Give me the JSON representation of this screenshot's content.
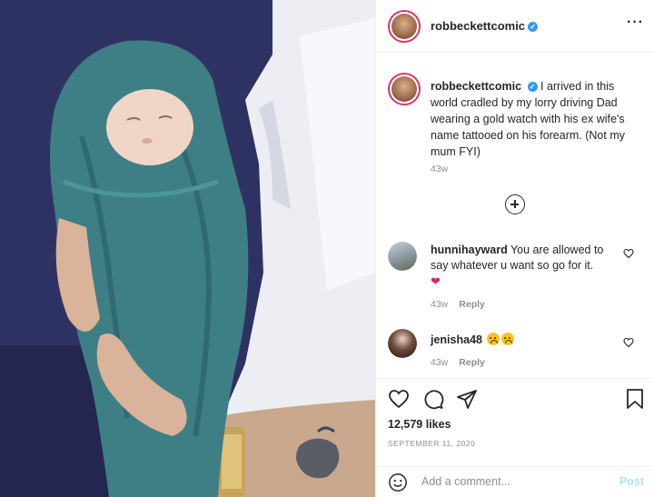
{
  "post": {
    "username": "robbeckettcomic",
    "verified_mark": "✓",
    "more_label": "···",
    "caption": "I arrived in this world cradled by my lorry driving Dad wearing a gold watch with his ex wife's name tattooed on his forearm. (Not my mum FYI)",
    "caption_time": "43w",
    "load_more_icon": "plus-circle-icon"
  },
  "comments": [
    {
      "username": "hunnihayward",
      "text": "You are allowed to say whatever u want so go for it.",
      "emoji": "❤",
      "time": "43w",
      "reply_label": "Reply"
    },
    {
      "username": "jenisha48",
      "text": "",
      "emoji_name": "sad-face-emoji",
      "time": "43w",
      "reply_label": "Reply"
    }
  ],
  "actions": {
    "likes": "12,579 likes",
    "date": "SEPTEMBER 11, 2020",
    "icons": [
      "heart-icon",
      "comment-icon",
      "share-icon",
      "bookmark-icon"
    ]
  },
  "comment_box": {
    "placeholder": "Add a comment...",
    "post_label": "Post"
  },
  "colors": {
    "link_blue": "#3897f0",
    "post_disabled": "#b2dffc",
    "muted": "#8e8e8e"
  }
}
